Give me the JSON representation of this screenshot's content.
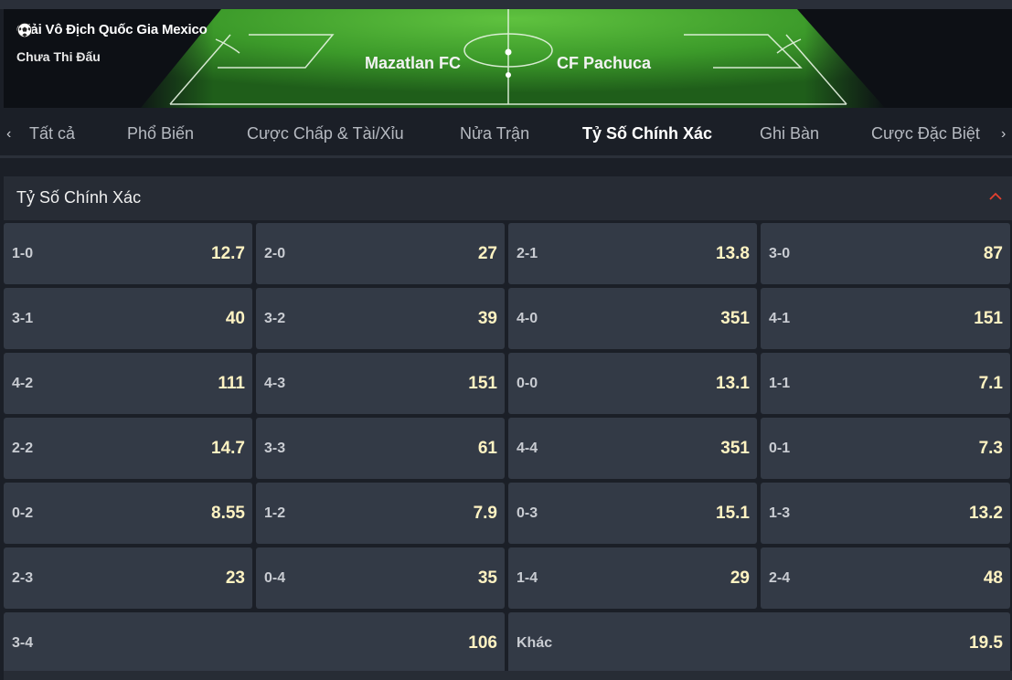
{
  "match": {
    "league": "Giải Vô Địch Quốc Gia Mexico",
    "status": "Chưa Thi Đấu",
    "home_team": "Mazatlan FC",
    "away_team": "CF Pachuca"
  },
  "tabs": [
    {
      "label": "Tất cả",
      "active": false
    },
    {
      "label": "Phổ Biến",
      "active": false
    },
    {
      "label": "Cược Chấp & Tài/Xỉu",
      "active": false
    },
    {
      "label": "Nửa Trận",
      "active": false
    },
    {
      "label": "Tỷ Số Chính Xác",
      "active": true
    },
    {
      "label": "Ghi Bàn",
      "active": false
    },
    {
      "label": "Cược Đặc Biệt",
      "active": false
    }
  ],
  "nav": {
    "prev_glyph": "‹",
    "next_glyph": "›"
  },
  "market": {
    "title": "Tỷ Số Chính Xác",
    "rows": [
      [
        {
          "score": "1-0",
          "odds": "12.7"
        },
        {
          "score": "2-0",
          "odds": "27"
        },
        {
          "score": "2-1",
          "odds": "13.8"
        },
        {
          "score": "3-0",
          "odds": "87"
        }
      ],
      [
        {
          "score": "3-1",
          "odds": "40"
        },
        {
          "score": "3-2",
          "odds": "39"
        },
        {
          "score": "4-0",
          "odds": "351"
        },
        {
          "score": "4-1",
          "odds": "151"
        }
      ],
      [
        {
          "score": "4-2",
          "odds": "111"
        },
        {
          "score": "4-3",
          "odds": "151"
        },
        {
          "score": "0-0",
          "odds": "13.1"
        },
        {
          "score": "1-1",
          "odds": "7.1"
        }
      ],
      [
        {
          "score": "2-2",
          "odds": "14.7"
        },
        {
          "score": "3-3",
          "odds": "61"
        },
        {
          "score": "4-4",
          "odds": "351"
        },
        {
          "score": "0-1",
          "odds": "7.3"
        }
      ],
      [
        {
          "score": "0-2",
          "odds": "8.55"
        },
        {
          "score": "1-2",
          "odds": "7.9"
        },
        {
          "score": "0-3",
          "odds": "15.1"
        },
        {
          "score": "1-3",
          "odds": "13.2"
        }
      ],
      [
        {
          "score": "2-3",
          "odds": "23"
        },
        {
          "score": "0-4",
          "odds": "35"
        },
        {
          "score": "1-4",
          "odds": "29"
        },
        {
          "score": "2-4",
          "odds": "48"
        }
      ]
    ],
    "last_row": [
      {
        "score": "3-4",
        "odds": "106"
      },
      {
        "score": "Khác",
        "odds": "19.5"
      }
    ]
  },
  "colors": {
    "accent": "#e5402f",
    "cell_bg": "#333a46",
    "odds_text": "#fff3c2",
    "pitch_green": "#3f9a2d"
  },
  "icons": {
    "league": "soccer-ball-icon",
    "collapse": "chevron-up-icon"
  }
}
